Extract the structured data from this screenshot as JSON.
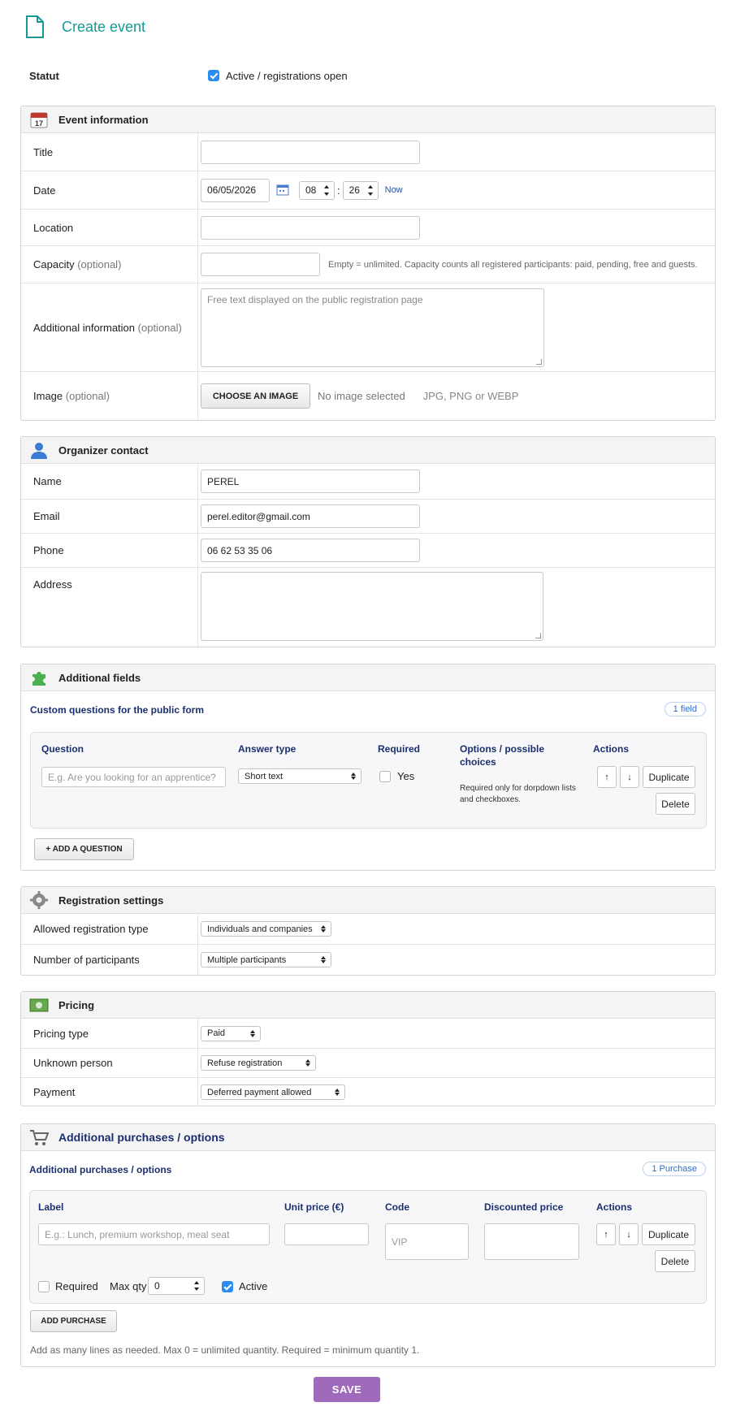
{
  "header": {
    "title": "Create event",
    "icon": "document-icon"
  },
  "status": {
    "label": "Statut",
    "checkbox_label": "Active / registrations open",
    "checked": true
  },
  "event_info": {
    "title": "Event information",
    "fields": {
      "title_label": "Title",
      "date_label": "Date",
      "date_value": "06/05/2026",
      "hour_value": "08",
      "minute_value": "26",
      "time_separator": ":",
      "now_link": "Now",
      "location_label": "Location",
      "capacity_label": "Capacity",
      "capacity_optional": "(optional)",
      "capacity_help": "Empty = unlimited. Capacity counts all registered participants: paid, pending, free and guests.",
      "additional_label": "Additional information",
      "additional_optional": "(optional)",
      "additional_placeholder": "Free text displayed on the public registration page",
      "image_label": "Image",
      "image_optional": "(optional)",
      "image_button": "CHOOSE AN IMAGE",
      "image_status": "No image selected",
      "image_formats": "JPG, PNG or WEBP"
    }
  },
  "organizer": {
    "title": "Organizer contact",
    "name_label": "Name",
    "name_value": "PEREL",
    "email_label": "Email",
    "email_value": "perel.editor@gmail.com",
    "phone_label": "Phone",
    "phone_value": "06 62 53 35 06",
    "address_label": "Address"
  },
  "additional_fields": {
    "title": "Additional fields",
    "subtitle": "Custom questions for the public form",
    "badge": "1 field",
    "columns": {
      "question": "Question",
      "answer_type": "Answer type",
      "required": "Required",
      "options": "Options / possible choices",
      "actions": "Actions"
    },
    "row": {
      "question_placeholder": "E.g. Are you looking for an apprentice?",
      "answer_type": "Short text",
      "required_label": "Yes",
      "options_help": "Required only for dorpdown lists and checkboxes.",
      "up": "↑",
      "down": "↓",
      "duplicate": "Duplicate",
      "delete": "Delete"
    },
    "add_button": "+ ADD A QUESTION"
  },
  "registration": {
    "title": "Registration settings",
    "type_label": "Allowed registration type",
    "type_value": "Individuals and companies",
    "participants_label": "Number of participants",
    "participants_value": "Multiple participants"
  },
  "pricing": {
    "title": "Pricing",
    "type_label": "Pricing type",
    "type_value": "Paid",
    "unknown_label": "Unknown person",
    "unknown_value": "Refuse registration",
    "payment_label": "Payment",
    "payment_value": "Deferred payment allowed"
  },
  "purchases": {
    "title": "Additional purchases / options",
    "subtitle": "Additional purchases / options",
    "badge": "1 Purchase",
    "columns": {
      "label": "Label",
      "unit_price": "Unit price (€)",
      "code": "Code",
      "discounted": "Discounted price",
      "actions": "Actions"
    },
    "row": {
      "label_placeholder": "E.g.: Lunch, premium workshop, meal seat",
      "code_placeholder": "VIP",
      "up": "↑",
      "down": "↓",
      "duplicate": "Duplicate",
      "delete": "Delete",
      "required_label": "Required",
      "required_checked": false,
      "maxqty_label": "Max qty",
      "maxqty_value": "0",
      "active_label": "Active",
      "active_checked": true
    },
    "add_button": "ADD PURCHASE",
    "help": "Add as many lines as needed. Max 0 = unlimited quantity. Required = minimum quantity 1."
  },
  "save_button": "SAVE",
  "colors": {
    "accent": "#179a94",
    "save": "#a06abc",
    "checkbox": "#2d8cf0",
    "subheading": "#1a2f6e"
  }
}
